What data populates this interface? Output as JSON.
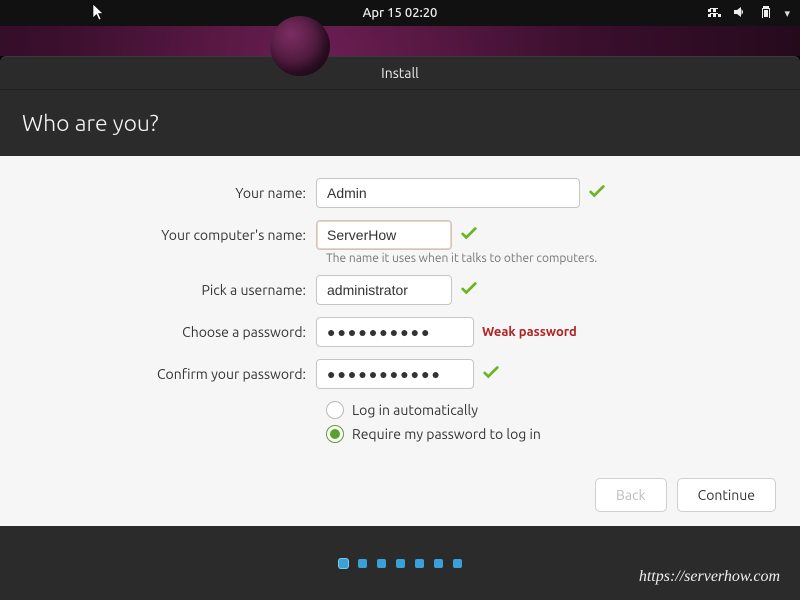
{
  "topbar": {
    "datetime": "Apr 15  02:20"
  },
  "window": {
    "title": "Install"
  },
  "header": {
    "title": "Who are you?"
  },
  "form": {
    "name_label": "Your name:",
    "name_value": "Admin",
    "computer_label": "Your computer's name:",
    "computer_value": "ServerHow",
    "computer_hint": "The name it uses when it talks to other computers.",
    "username_label": "Pick a username:",
    "username_value": "administrator",
    "password_label": "Choose a password:",
    "password_value": "●●●●●●●●●●",
    "password_strength": "Weak password",
    "confirm_label": "Confirm your password:",
    "confirm_value": "●●●●●●●●●●●",
    "login_auto_label": "Log in automatically",
    "login_require_label": "Require my password to log in",
    "login_selected": "require"
  },
  "buttons": {
    "back": "Back",
    "continue": "Continue"
  },
  "progress": {
    "total": 7,
    "current": 1
  },
  "credit": "https://serverhow.com"
}
